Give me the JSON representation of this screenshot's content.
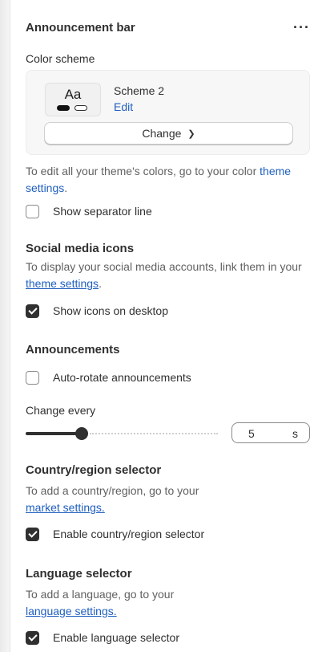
{
  "header": {
    "title": "Announcement bar",
    "menu_icon": "more-horizontal-icon",
    "menu_glyph": "···"
  },
  "color_scheme": {
    "label": "Color scheme",
    "swatch_text": "Aa",
    "name": "Scheme 2",
    "edit_label": "Edit",
    "change_label": "Change",
    "chevron_glyph": "⌵"
  },
  "theme_colors_help": {
    "prefix": "To edit all your theme's colors, go to your color ",
    "link": "theme settings",
    "suffix": "."
  },
  "separator": {
    "label": "Show separator line",
    "checked": false
  },
  "social": {
    "heading": "Social media icons",
    "help_prefix": "To display your social media accounts, link them in your ",
    "help_link": "theme settings",
    "help_suffix": ".",
    "show_desktop_label": "Show icons on desktop",
    "show_desktop_checked": true
  },
  "announcements": {
    "heading": "Announcements",
    "auto_rotate_label": "Auto-rotate announcements",
    "auto_rotate_checked": false,
    "change_every_label": "Change every",
    "slider_fraction": 0.29,
    "value": "5",
    "unit": "s"
  },
  "country": {
    "heading": "Country/region selector",
    "help_prefix": "To add a country/region, go to your ",
    "help_link": "market settings.",
    "enable_label": "Enable country/region selector",
    "enable_checked": true
  },
  "language": {
    "heading": "Language selector",
    "help_prefix": "To add a language, go to your ",
    "help_link": "language settings.",
    "enable_label": "Enable language selector",
    "enable_checked": true
  },
  "colors": {
    "link": "#1f5fbf",
    "checkbox_checked": "#303030"
  }
}
